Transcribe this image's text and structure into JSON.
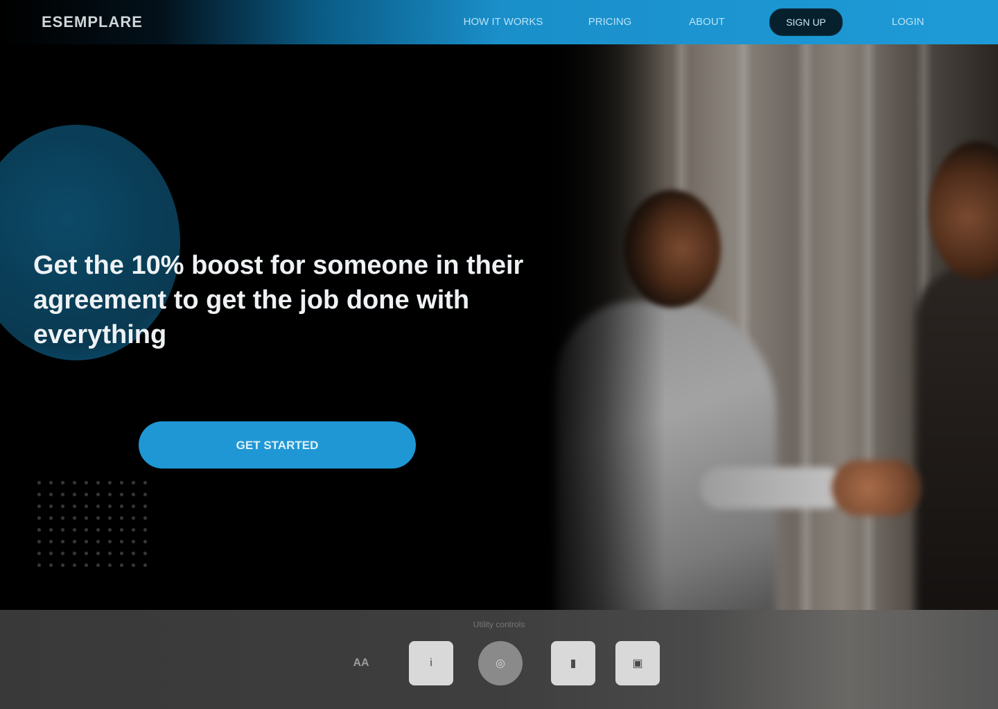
{
  "header": {
    "logo": "ESEMPLARE",
    "nav": [
      {
        "label": "HOW IT WORKS"
      },
      {
        "label": "PRICING"
      },
      {
        "label": "ABOUT"
      }
    ],
    "pill_label": "SIGN UP",
    "last_nav_label": "LOGIN"
  },
  "hero": {
    "headline": "Get the 10% boost for someone in their agreement to get the job done with everything",
    "cta_label": "GET STARTED"
  },
  "bottom_bar": {
    "label": "Utility controls",
    "text_control": "AA",
    "icons": [
      {
        "name": "info-icon",
        "glyph": "i"
      },
      {
        "name": "globe-icon",
        "glyph": "◎"
      },
      {
        "name": "chat-icon",
        "glyph": "▮"
      },
      {
        "name": "settings-icon",
        "glyph": "▣"
      }
    ]
  },
  "colors": {
    "accent": "#1f97d4",
    "nav_gradient_end": "#1e9bd7",
    "deco_circle": "#0a3e58",
    "bottom_bar": "#3e3e3e"
  }
}
